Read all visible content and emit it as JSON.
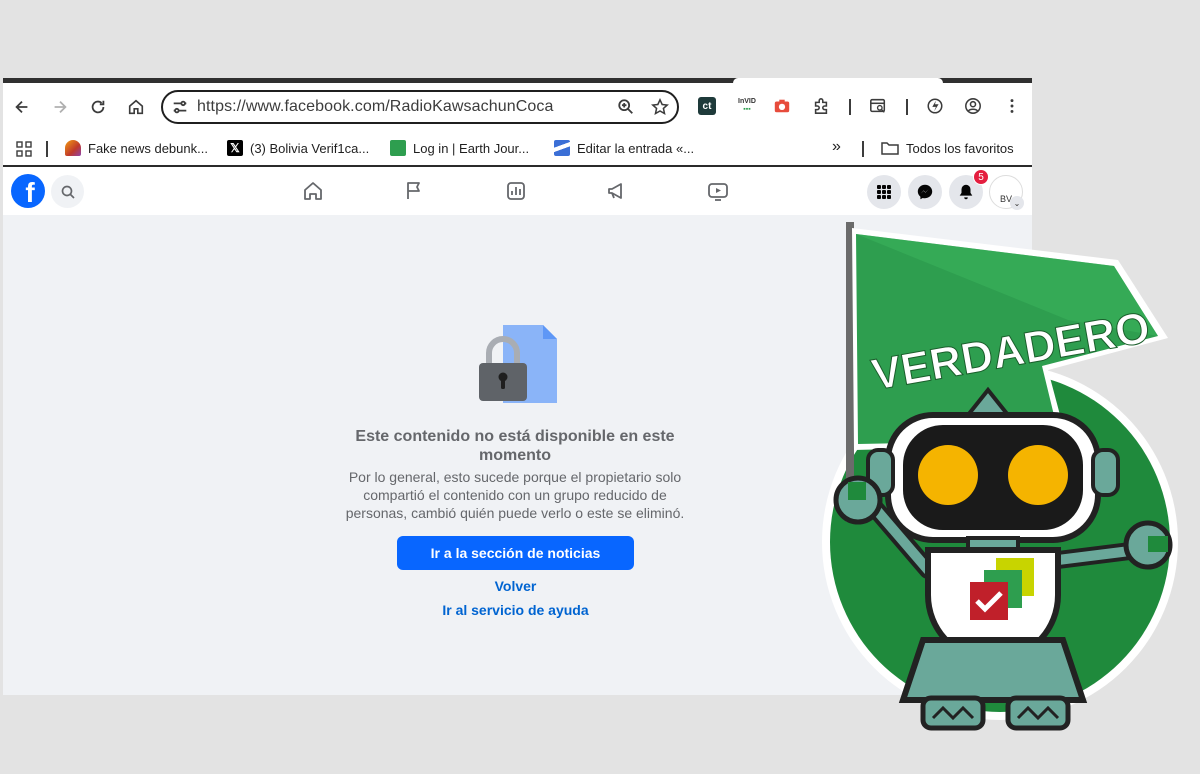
{
  "browser": {
    "url": "https://www.facebook.com/RadioKawsachunCoca",
    "extensions": [
      {
        "icon": "ct-extension-icon",
        "label": "ct"
      },
      {
        "icon": "invid-extension-icon",
        "label": "InVID"
      },
      {
        "icon": "camera-extension-icon"
      },
      {
        "icon": "puzzle-icon"
      },
      {
        "icon": "tab-search-icon"
      },
      {
        "icon": "performance-icon"
      },
      {
        "icon": "profile-icon"
      },
      {
        "icon": "menu-icon"
      }
    ],
    "bookmarks": [
      {
        "label": "Fake news debunk...",
        "icon": "globe-favicon",
        "color": "#c0392b"
      },
      {
        "label": "(3) Bolivia Verif1ca...",
        "icon": "x-favicon",
        "color": "#000000"
      },
      {
        "label": "Log in | Earth Jour...",
        "icon": "earth-journal-favicon",
        "color": "#2e9e4f"
      },
      {
        "label": "Editar la entrada «...",
        "icon": "wordpress-favicon",
        "color": "#3b6fd6"
      }
    ],
    "overflow_label": "»",
    "all_bookmarks_label": "Todos los favoritos"
  },
  "facebook": {
    "notification_count": "5",
    "avatar_initials": "BV",
    "unavailable": {
      "title": "Este contenido no está disponible en este momento",
      "body": "Por lo general, esto sucede porque el propietario solo compartió el contenido con un grupo reducido de personas, cambió quién puede verlo o este se eliminó.",
      "primary_button": "Ir a la sección de noticias",
      "back_link": "Volver",
      "help_link": "Ir al servicio de ayuda"
    },
    "colors": {
      "brand": "#0866ff",
      "link": "#0064d1",
      "muted_text": "#65676b"
    }
  },
  "sticker": {
    "label": "VERDADERO",
    "colors": {
      "flag": "#2e9e4f",
      "circle": "#1f8a3c",
      "eyes": "#f5b400"
    }
  }
}
